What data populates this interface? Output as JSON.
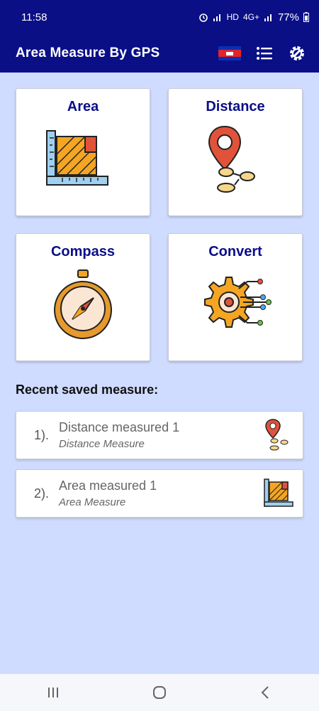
{
  "status_bar": {
    "time": "11:58",
    "network": "HD",
    "signal": "4G+",
    "battery": "77%"
  },
  "app_bar": {
    "title": "Area Measure By GPS",
    "icons": [
      "cambodia-flag-icon",
      "list-icon",
      "settings-gear-icon"
    ]
  },
  "tiles": [
    {
      "label": "Area",
      "icon": "area-ruler-icon"
    },
    {
      "label": "Distance",
      "icon": "distance-pin-icon"
    },
    {
      "label": "Compass",
      "icon": "compass-icon"
    },
    {
      "label": "Convert",
      "icon": "convert-gear-icon"
    }
  ],
  "recent": {
    "title": "Recent saved measure:",
    "items": [
      {
        "index": "1).",
        "name": "Distance measured 1",
        "type": "Distance Measure",
        "icon": "distance-pin-icon"
      },
      {
        "index": "2).",
        "name": "Area measured 1",
        "type": "Area Measure",
        "icon": "area-ruler-icon"
      }
    ]
  },
  "nav_bar": {
    "icons": [
      "recent-apps-icon",
      "home-icon",
      "back-icon"
    ]
  },
  "colors": {
    "primary": "#0a0f86",
    "background": "#cfdcff",
    "accent_orange": "#f4a623",
    "accent_red": "#e0533a"
  }
}
